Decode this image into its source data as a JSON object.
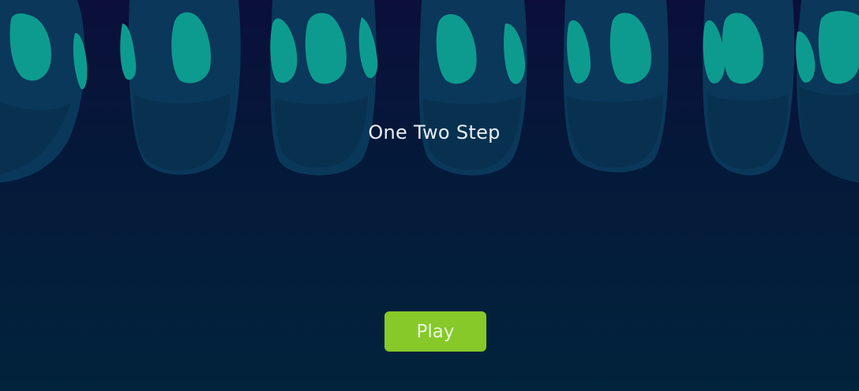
{
  "game": {
    "title": "One Two Step",
    "play_label": "Play"
  },
  "colors": {
    "background_top": "#0b0f3a",
    "background_bottom": "#02233c",
    "footprint_dark": "#0b3a5c",
    "footprint_light": "#0e9b8f",
    "play_button": "#86c928",
    "title_text": "#e9eef7"
  }
}
